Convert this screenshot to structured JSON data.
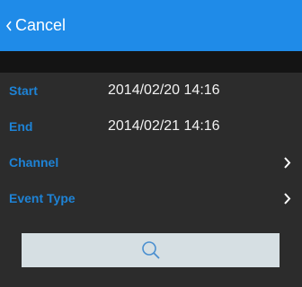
{
  "header": {
    "cancel_label": "Cancel",
    "accent_color": "#1f8be8"
  },
  "form": {
    "rows": [
      {
        "label": "Start",
        "value": "2014/02/20 14:16"
      },
      {
        "label": "End",
        "value": "2014/02/21 14:16"
      },
      {
        "label": "Channel",
        "value": ""
      },
      {
        "label": "Event Type",
        "value": ""
      }
    ],
    "label_color": "#1e83d6"
  },
  "search": {
    "icon": "search-icon"
  }
}
